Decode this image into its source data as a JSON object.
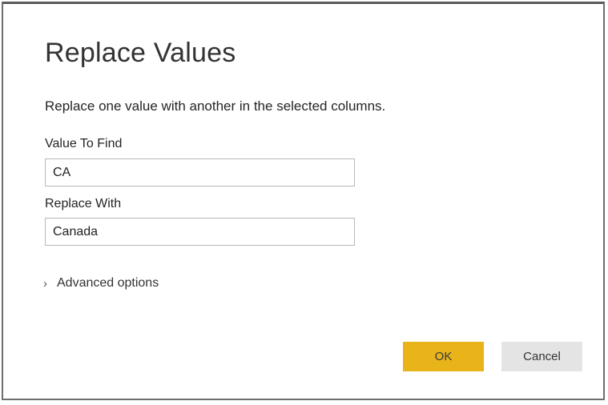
{
  "dialog": {
    "title": "Replace Values",
    "description": "Replace one value with another in the selected columns.",
    "value_to_find": {
      "label": "Value To Find",
      "value": "CA"
    },
    "replace_with": {
      "label": "Replace With",
      "value": "Canada"
    },
    "advanced_options": {
      "label": "Advanced options",
      "icon": "chevron-right-icon",
      "expanded": false
    },
    "buttons": {
      "ok_label": "OK",
      "cancel_label": "Cancel"
    },
    "colors": {
      "ok_button": "#e8b41a",
      "cancel_button": "#e4e4e4"
    }
  }
}
